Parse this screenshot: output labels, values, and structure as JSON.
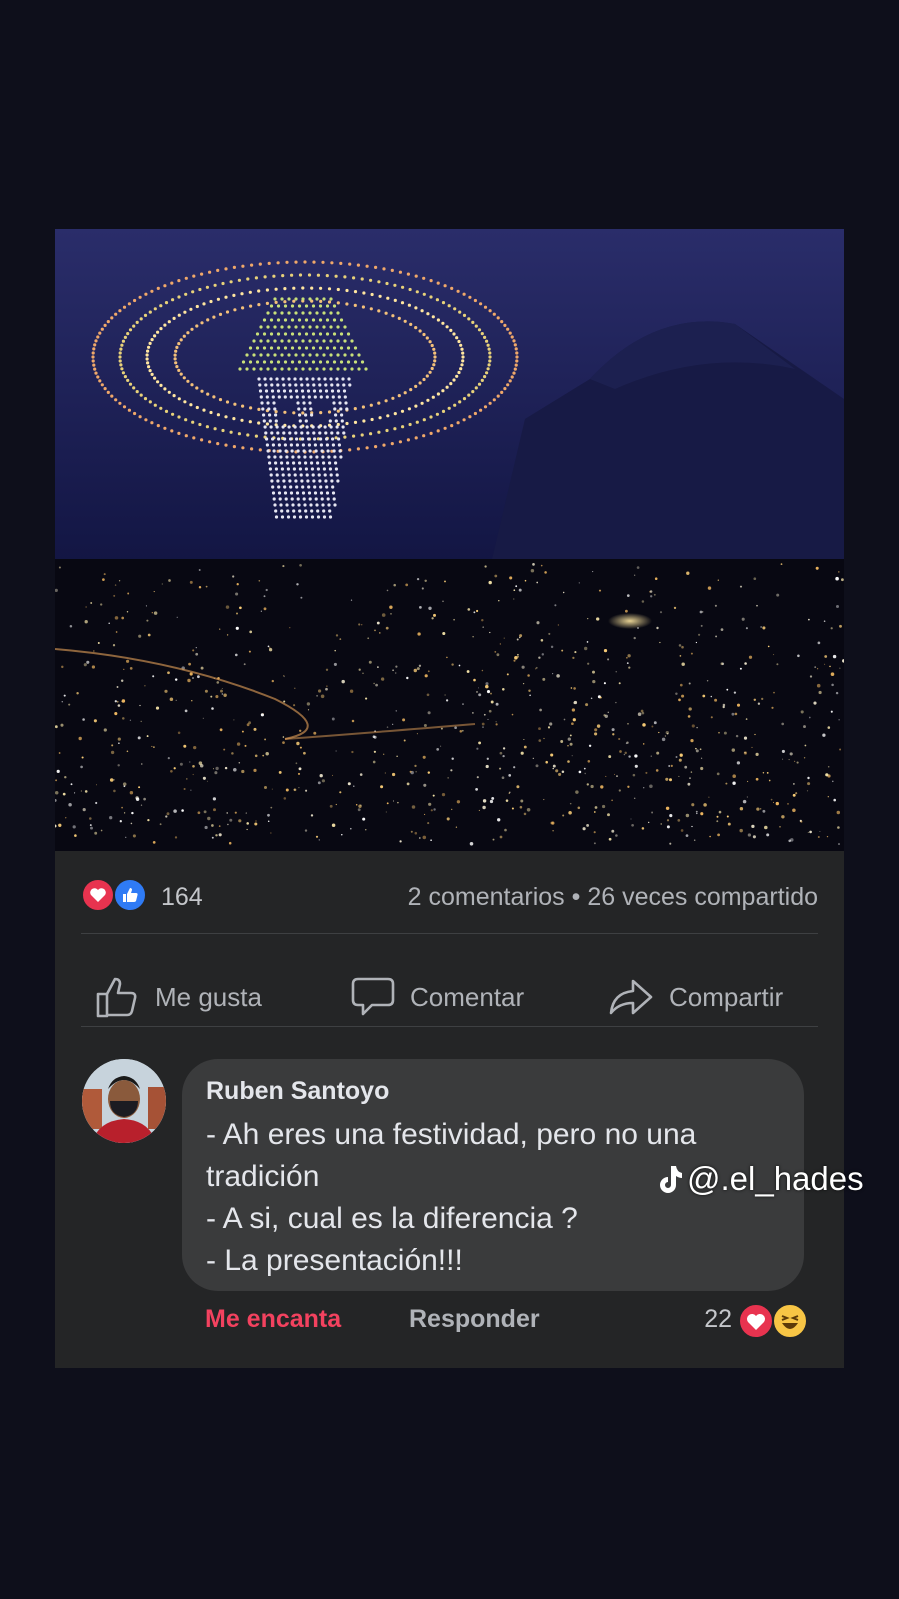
{
  "post": {
    "reaction_count": "164",
    "stats": "2 comentarios • 26 veces compartido",
    "reaction_icons": [
      "love-icon",
      "like-icon"
    ],
    "colors": {
      "love": "#e8334f",
      "like": "#2f7bf5",
      "card": "#242526",
      "bubble": "#3a3b3c",
      "page": "#0e0f1b"
    }
  },
  "actions": {
    "like_label": "Me gusta",
    "comment_label": "Comentar",
    "share_label": "Compartir"
  },
  "comment": {
    "author": "Ruben Santoyo",
    "lines": [
      "- Ah eres una festividad, pero no una",
      "tradición",
      "- A si, cual es la diferencia ?",
      "- La presentación!!!"
    ],
    "love_label": "Me encanta",
    "reply_label": "Responder",
    "reaction_count": "22",
    "reaction_icons": [
      "love-icon",
      "haha-icon"
    ]
  },
  "watermark": {
    "handle": "@.el_hades",
    "icon": "tiktok-icon"
  }
}
